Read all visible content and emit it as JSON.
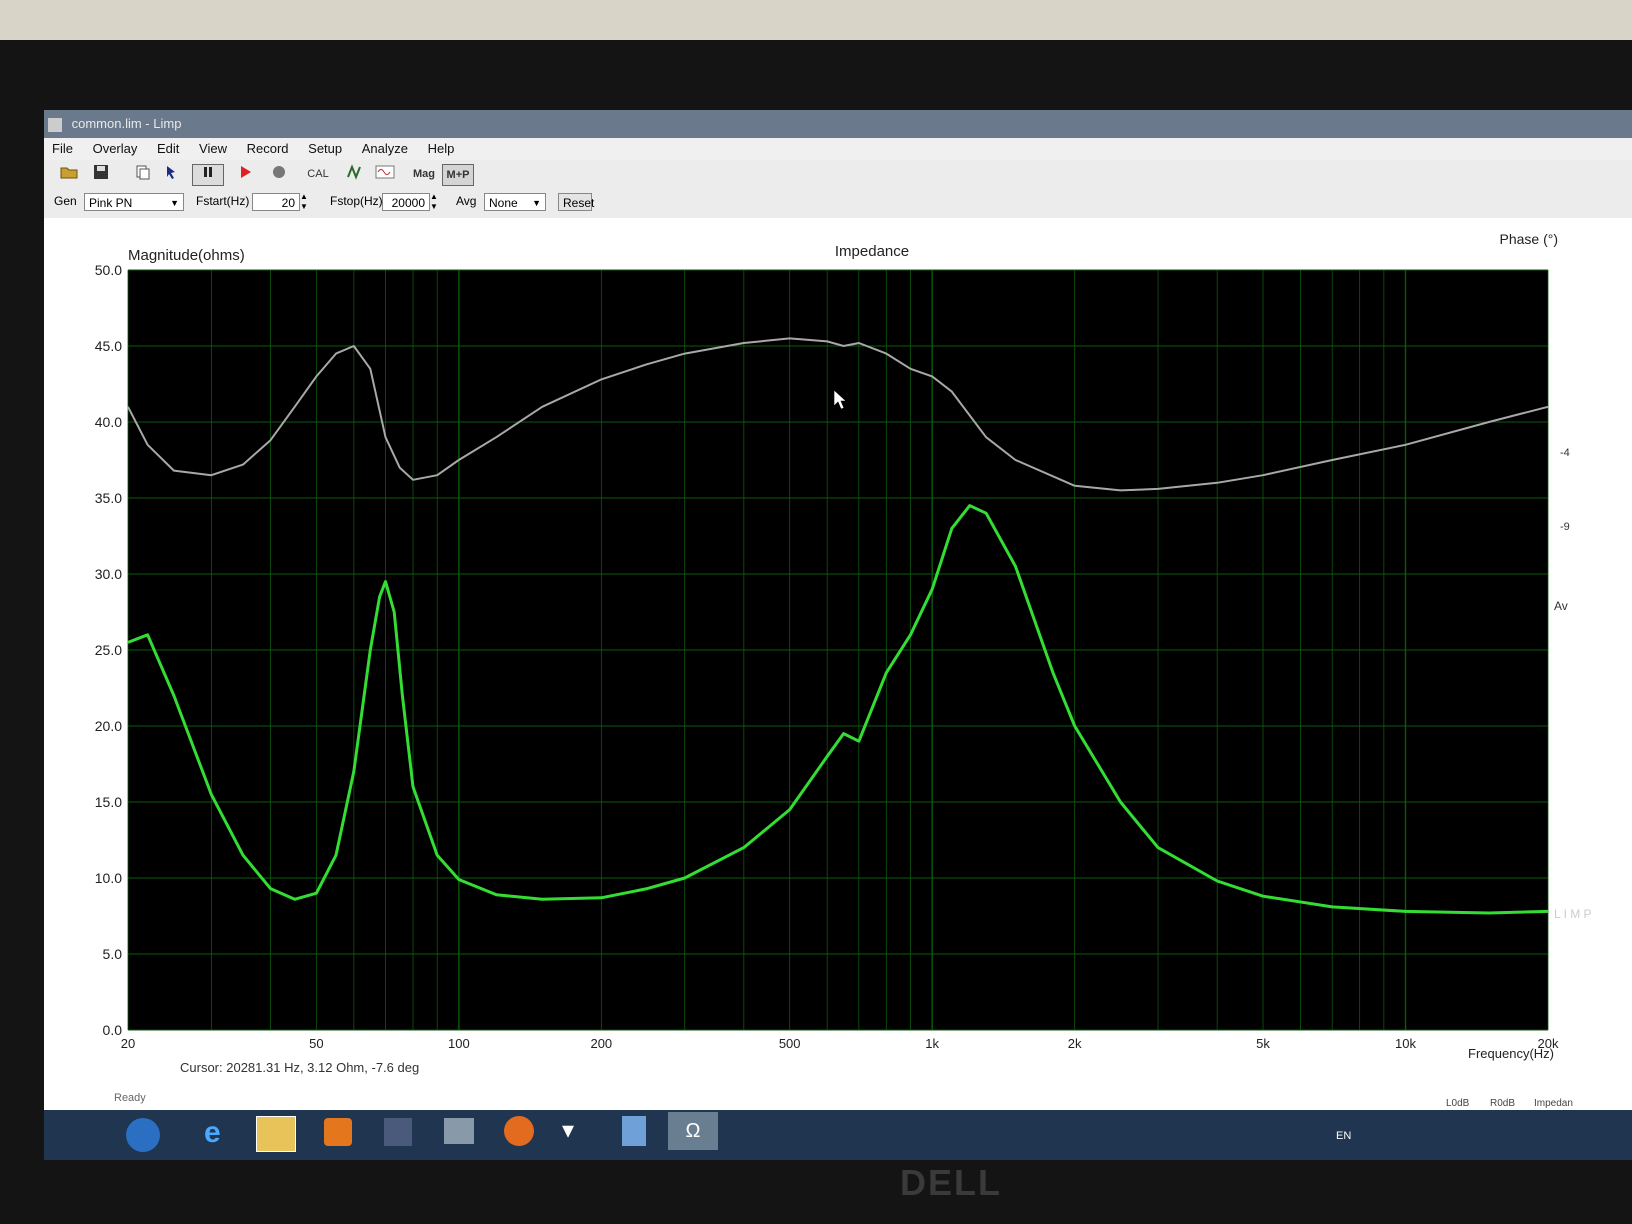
{
  "window": {
    "title": "common.lim - Limp"
  },
  "menu": [
    "File",
    "Overlay",
    "Edit",
    "View",
    "Record",
    "Setup",
    "Analyze",
    "Help"
  ],
  "toolbar": {
    "cal_label": "CAL",
    "mag_label": "Mag",
    "mp_label": "M+P"
  },
  "controls": {
    "gen_label": "Gen",
    "gen_value": "Pink PN",
    "fstart_label": "Fstart(Hz)",
    "fstart_value": "20",
    "fstop_label": "Fstop(Hz)",
    "fstop_value": "20000",
    "avg_label": "Avg",
    "avg_value": "None",
    "reset_label": "Reset"
  },
  "status": {
    "cursor": "Cursor: 20281.31 Hz, 3.12 Ohm, -7.6 deg",
    "ready": "Ready",
    "lang": "EN",
    "bottom_labels": [
      "L0dB",
      "R0dB",
      "Impedan"
    ]
  },
  "side_labels": {
    "right_marker": "L I M P",
    "phase_partial_1": "-4",
    "phase_partial_2": "-9",
    "avg_partial": "Av"
  },
  "colors": {
    "plot_bg": "#000000",
    "grid": "#0d5a0d",
    "magnitude": "#33dd33",
    "phase": "#a8a8a8"
  },
  "chart_data": {
    "type": "line",
    "title": "Impedance",
    "ylabel": "Magnitude(ohms)",
    "y2label": "Phase (°)",
    "xlabel": "Frequency(Hz)",
    "x_scale": "log",
    "xlim": [
      20,
      20000
    ],
    "ylim": [
      0,
      50
    ],
    "x_ticks": [
      20,
      50,
      100,
      200,
      500,
      1000,
      2000,
      5000,
      10000,
      20000
    ],
    "x_tick_labels": [
      "20",
      "50",
      "100",
      "200",
      "500",
      "1k",
      "2k",
      "5k",
      "10k",
      "20k"
    ],
    "y_ticks": [
      0,
      5,
      10,
      15,
      20,
      25,
      30,
      35,
      40,
      45,
      50
    ],
    "y_tick_labels": [
      "0.0",
      "5.0",
      "10.0",
      "15.0",
      "20.0",
      "25.0",
      "30.0",
      "35.0",
      "40.0",
      "45.0",
      "50.0"
    ],
    "grid": true,
    "series": [
      {
        "name": "magnitude",
        "color": "#33dd33",
        "x": [
          20,
          22,
          25,
          30,
          35,
          40,
          45,
          50,
          55,
          60,
          65,
          68,
          70,
          73,
          76,
          80,
          90,
          100,
          120,
          150,
          200,
          250,
          300,
          400,
          500,
          600,
          650,
          700,
          800,
          900,
          1000,
          1100,
          1200,
          1300,
          1500,
          1800,
          2000,
          2500,
          3000,
          4000,
          5000,
          7000,
          10000,
          15000,
          20000
        ],
        "y": [
          25.5,
          26.0,
          22.0,
          15.5,
          11.5,
          9.3,
          8.6,
          9.0,
          11.5,
          17.0,
          25.0,
          28.5,
          29.5,
          27.5,
          22.0,
          16.0,
          11.5,
          9.9,
          8.9,
          8.6,
          8.7,
          9.3,
          10.0,
          12.0,
          14.5,
          18.0,
          19.5,
          19.0,
          23.5,
          26.0,
          29.0,
          33.0,
          34.5,
          34.0,
          30.5,
          23.5,
          20.0,
          15.0,
          12.0,
          9.8,
          8.8,
          8.1,
          7.8,
          7.7,
          7.8
        ]
      },
      {
        "name": "phase",
        "color": "#a8a8a8",
        "x": [
          20,
          22,
          25,
          30,
          35,
          40,
          45,
          50,
          55,
          60,
          65,
          70,
          75,
          80,
          90,
          100,
          120,
          150,
          200,
          250,
          300,
          400,
          500,
          600,
          650,
          700,
          800,
          900,
          1000,
          1100,
          1300,
          1500,
          2000,
          2500,
          3000,
          4000,
          5000,
          7000,
          10000,
          15000,
          20000
        ],
        "y": [
          41.0,
          38.5,
          36.8,
          36.5,
          37.2,
          38.8,
          41.0,
          43.0,
          44.5,
          45.0,
          43.5,
          39.0,
          37.0,
          36.2,
          36.5,
          37.5,
          39.0,
          41.0,
          42.8,
          43.8,
          44.5,
          45.2,
          45.5,
          45.3,
          45.0,
          45.2,
          44.5,
          43.5,
          43.0,
          42.0,
          39.0,
          37.5,
          35.8,
          35.5,
          35.6,
          36.0,
          36.5,
          37.5,
          38.5,
          40.0,
          41.0
        ]
      }
    ]
  }
}
